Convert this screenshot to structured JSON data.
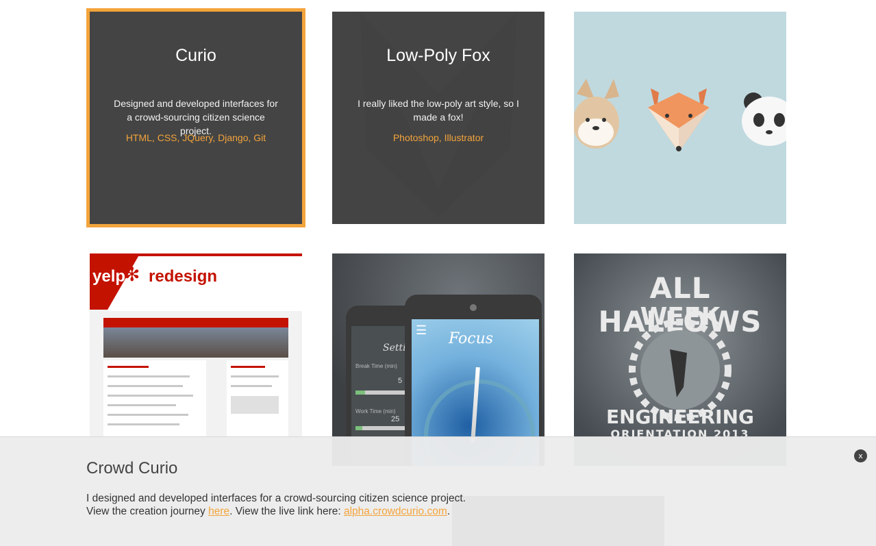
{
  "portfolio": {
    "tiles": [
      {
        "title": "Curio",
        "description": "Designed and developed interfaces for a crowd-sourcing citizen science project.",
        "tags": "HTML, CSS, JQuery, Django, Git",
        "selected": true
      },
      {
        "title": "Low-Poly Fox",
        "description": "I really liked the low-poly art style, so I made a fox!",
        "tags": "Photoshop, Illustrator"
      },
      {
        "image": "flat-animals",
        "selected": false
      },
      {
        "image": "yelp-redesign",
        "brand": "yelp",
        "heading": "redesign"
      },
      {
        "image": "focus-app",
        "app_title": "Focus",
        "settings_title": "Settings",
        "break_label": "Break Time (min)",
        "break_value": "5",
        "work_label": "Work Time (min)",
        "work_value": "25"
      },
      {
        "image": "all-hallows-week",
        "line1": "ALL HALLOWS",
        "line2": "WEEK",
        "line3": "ENGINEERING",
        "line4": "ORIENTATION 2013"
      }
    ]
  },
  "detail_panel": {
    "title": "Crowd Curio",
    "line1": "I designed and developed interfaces for a crowd-sourcing citizen science project.",
    "line2_prefix": "View the creation journey ",
    "journey_link": "here",
    "line2_middle": ". View the live link here: ",
    "live_link": "alpha.crowdcurio.com",
    "line2_suffix": ".",
    "close_label": "x"
  },
  "colors": {
    "accent": "#f3a43b",
    "overlay": "#3a3a3a",
    "yelp_red": "#c41200",
    "animal_bg": "#c0d9df"
  }
}
